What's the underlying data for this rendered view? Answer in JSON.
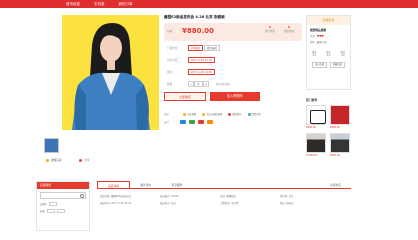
{
  "topbar": {
    "color": "#e02e2e",
    "nav": [
      "首页欢迎",
      "手机逛",
      "我的订单"
    ]
  },
  "product": {
    "title": "魔盟E2新品发布会 4.26 北京 张靓颖",
    "price_label": "价格",
    "price": "¥880.00",
    "stats": [
      {
        "value": "0",
        "label": "累计评论"
      },
      {
        "value": "0",
        "label": "交易成功"
      }
    ],
    "spec_label": "门票档位",
    "specs": [
      "VIP座位",
      "看台座位"
    ],
    "date_label": "演出时间",
    "dates": [
      "2017-4-26 19:30"
    ],
    "session_label": "场次",
    "sessions": [
      "2017-4-26 19:30"
    ],
    "qty_label": "数量",
    "qty": "1",
    "qty_unit": "件(库存充足)",
    "buy_button": "立即购买",
    "cart_button": "加入购物车",
    "promise_label": "服务",
    "promises": [
      {
        "text": "正品保障",
        "color": "#f2b01e"
      },
      {
        "text": "七天无理由退换",
        "color": "#f2b01e"
      },
      {
        "text": "赠送积分",
        "color": "#e6443b"
      },
      {
        "text": "货到付款",
        "color": "#3da8e0"
      }
    ],
    "pay_label": "支付",
    "pay_colors": [
      "#1e88e5",
      "#43a047",
      "#e53935",
      "#fb8c00"
    ]
  },
  "share": {
    "favorite": "收藏店铺",
    "share": "分享"
  },
  "shop": {
    "header": "店铺名称",
    "name": "魔盟精品旗舰",
    "credit_label": "信誉",
    "hearts": "♥♥♥",
    "seller_label": "掌柜",
    "seller": "魔盟小编",
    "scores": [
      {
        "label": "描述",
        "value": "4.8"
      },
      {
        "label": "服务",
        "value": "4.8"
      },
      {
        "label": "物流",
        "value": "4.8"
      }
    ],
    "buttons": [
      "进入店铺",
      "收藏店铺"
    ]
  },
  "goods": {
    "title": "掌门推荐",
    "items": [
      {
        "style": "calli",
        "price": "¥880.00"
      },
      {
        "style": "red",
        "price": "¥880.00"
      },
      {
        "style": "p1",
        "price": "¥1080.00"
      },
      {
        "style": "p2",
        "price": "¥880.00"
      }
    ]
  },
  "sidebar": {
    "header": "店铺搜索",
    "keyword_label": "关键字",
    "price_label": "价格"
  },
  "tabs": [
    "商品详情",
    "累计评价",
    "专享服务"
  ],
  "tab_right": "手机购买",
  "details": [
    [
      "商品名称: 魔盟E2新品发布会",
      "商品编号: 10001",
      "店铺: 魔盟精品",
      "所在地: 北京"
    ],
    [
      "演出时间: 2017-4-26 19:30",
      "演出地点: 北京",
      "门票类型: 电子票",
      "座位: 按档位"
    ]
  ]
}
